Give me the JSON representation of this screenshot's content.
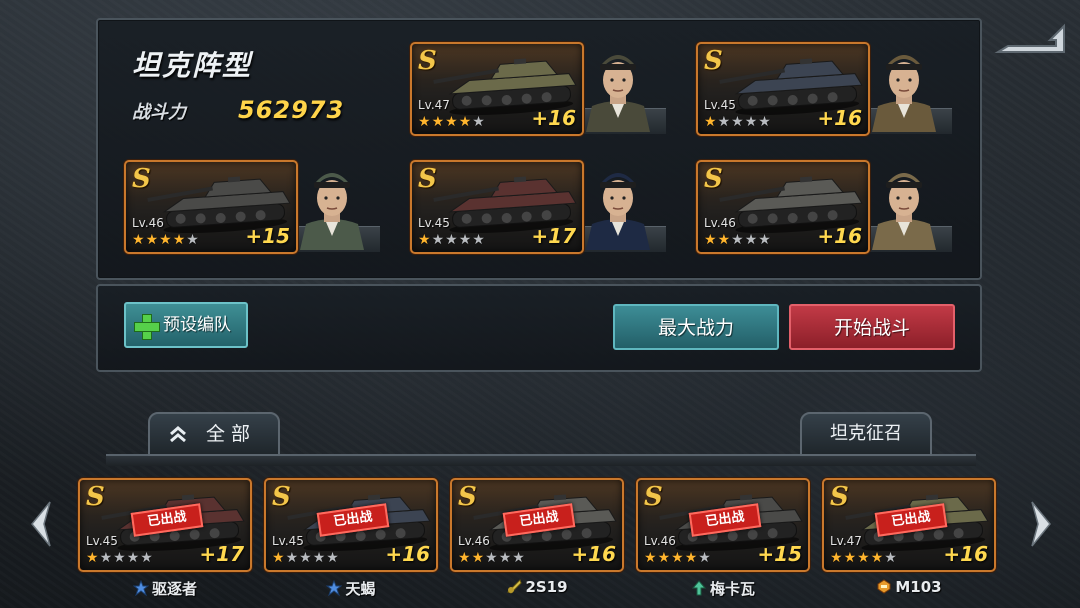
{
  "formation": {
    "title": "坦克阵型",
    "power_label": "战斗力",
    "power_value": "562973",
    "slots": [
      {
        "grade": "S",
        "level": "Lv.47",
        "stars": 4,
        "max_stars": 5,
        "bonus": "+16",
        "tank_color": "#6b6a4a",
        "commander_uniform": "#4a4a3a"
      },
      {
        "grade": "S",
        "level": "Lv.45",
        "stars": 1,
        "max_stars": 5,
        "bonus": "+16",
        "tank_color": "#3c4452",
        "commander_uniform": "#6a5a3c"
      },
      {
        "grade": "S",
        "level": "Lv.46",
        "stars": 4,
        "max_stars": 5,
        "bonus": "+15",
        "tank_color": "#4a4a48",
        "commander_uniform": "#4c5a4a"
      },
      {
        "grade": "S",
        "level": "Lv.45",
        "stars": 1,
        "max_stars": 5,
        "bonus": "+17",
        "tank_color": "#5a3230",
        "commander_uniform": "#1e2a44"
      },
      {
        "grade": "S",
        "level": "Lv.46",
        "stars": 2,
        "max_stars": 5,
        "bonus": "+16",
        "tank_color": "#5a5a56",
        "commander_uniform": "#7a6a4a"
      }
    ]
  },
  "actions": {
    "preset_label": "预设编队",
    "max_power_label": "最大战力",
    "start_battle_label": "开始战斗"
  },
  "tabs": {
    "all_label": "全 部",
    "recruit_label": "坦克征召"
  },
  "roster": [
    {
      "grade": "S",
      "level": "Lv.45",
      "stars": 1,
      "max_stars": 5,
      "bonus": "+17",
      "status": "已出战",
      "name": "驱逐者",
      "class_icon": "tank-destroyer-icon",
      "tank_color": "#5a3230"
    },
    {
      "grade": "S",
      "level": "Lv.45",
      "stars": 1,
      "max_stars": 5,
      "bonus": "+16",
      "status": "已出战",
      "name": "天蝎",
      "class_icon": "tank-destroyer-icon",
      "tank_color": "#3c4452"
    },
    {
      "grade": "S",
      "level": "Lv.46",
      "stars": 2,
      "max_stars": 5,
      "bonus": "+16",
      "status": "已出战",
      "name": "2S19",
      "class_icon": "artillery-icon",
      "tank_color": "#5a5a56"
    },
    {
      "grade": "S",
      "level": "Lv.46",
      "stars": 4,
      "max_stars": 5,
      "bonus": "+15",
      "status": "已出战",
      "name": "梅卡瓦",
      "class_icon": "medium-tank-icon",
      "tank_color": "#4a4a48"
    },
    {
      "grade": "S",
      "level": "Lv.47",
      "stars": 4,
      "max_stars": 5,
      "bonus": "+16",
      "status": "已出战",
      "name": "M103",
      "class_icon": "heavy-tank-icon",
      "tank_color": "#6b6a4a"
    }
  ],
  "colors": {
    "power_value": "#ffd44a",
    "card_border": "#c9782c",
    "star_on": "#ffb52e",
    "star_off": "#b9bcc0",
    "stamp_red": "#c8201c",
    "btn_teal": "#3d8d96",
    "btn_red": "#c23a46"
  }
}
